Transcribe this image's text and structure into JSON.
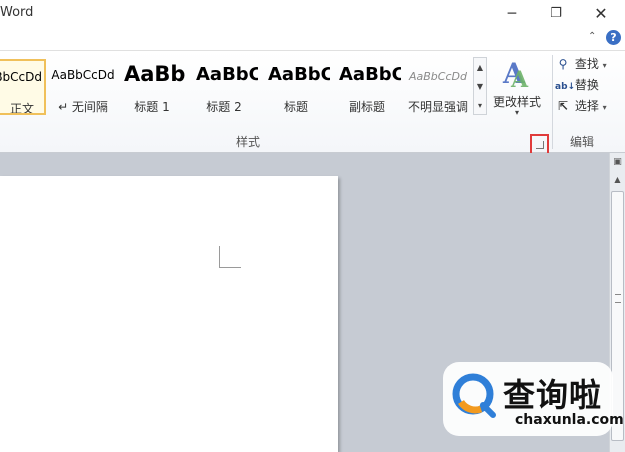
{
  "window": {
    "title": "Word",
    "minimize_glyph": "─",
    "maximize_glyph": "❐",
    "close_glyph": "✕"
  },
  "ribbon": {
    "collapse_glyph": "⌃",
    "help_glyph": "?",
    "styles_group": {
      "label": "样式",
      "gallery": [
        {
          "sample": "AaBbCcDd",
          "name": "正文",
          "selected": true
        },
        {
          "sample": "AaBbCcDd",
          "name": "↵ 无间隔"
        },
        {
          "sample": "AaBb",
          "name": "标题 1"
        },
        {
          "sample": "AaBbC",
          "name": "标题 2"
        },
        {
          "sample": "AaBbC",
          "name": "标题"
        },
        {
          "sample": "AaBbC",
          "name": "副标题"
        },
        {
          "sample": "AaBbCcDd",
          "name": "不明显强调"
        }
      ],
      "change_styles": {
        "label": "更改样式",
        "arrow": "▾"
      }
    },
    "editing_group": {
      "label": "编辑",
      "find": {
        "label": "查找",
        "icon": "find-icon"
      },
      "replace": {
        "label": "替换",
        "icon": "replace-icon"
      },
      "select": {
        "label": "选择",
        "icon": "select-cursor-icon"
      },
      "dropdown_arrow": "▾"
    }
  },
  "watermark": {
    "brand": "查询啦",
    "domain": "chaxunla.com"
  },
  "colors": {
    "selected_style_border": "#f0c05a",
    "highlight_box": "#e03b3b",
    "doc_background": "#c6cbd3",
    "help_blue": "#3a6fc4",
    "watermark_blue": "#2f7fd8",
    "watermark_orange": "#f29a1f"
  }
}
